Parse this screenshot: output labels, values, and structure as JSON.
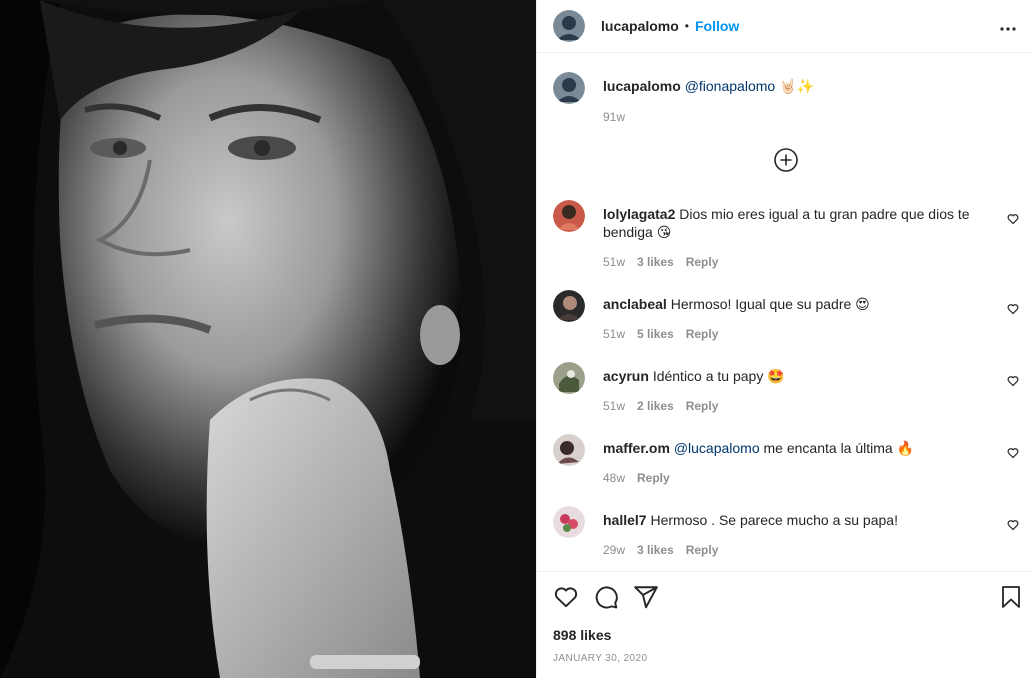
{
  "header": {
    "username": "lucapalomo",
    "separator": "•",
    "follow_label": "Follow"
  },
  "caption": {
    "username": "lucapalomo",
    "mention": "@fionapalomo",
    "emoji": "🤘🏻✨",
    "time": "91w"
  },
  "comments": [
    {
      "username": "lolylagata2",
      "pre": "",
      "mention": "",
      "text": "Dios mio eres igual a tu gran padre que dios te bendiga 😘",
      "time": "51w",
      "likes": "3 likes",
      "reply": "Reply"
    },
    {
      "username": "anclabeal",
      "pre": "",
      "mention": "",
      "text": "Hermoso! Igual que su padre 😍",
      "time": "51w",
      "likes": "5 likes",
      "reply": "Reply"
    },
    {
      "username": "acyrun",
      "pre": "",
      "mention": "",
      "text": "Idéntico a tu papy 🤩",
      "time": "51w",
      "likes": "2 likes",
      "reply": "Reply"
    },
    {
      "username": "maffer.om",
      "pre": "",
      "mention": "@lucapalomo",
      "text": "me encanta la última 🔥",
      "time": "48w",
      "likes": "",
      "reply": "Reply"
    },
    {
      "username": "hallel7",
      "pre": "",
      "mention": "",
      "text": "Hermoso . Se parece mucho a su papa!",
      "time": "29w",
      "likes": "3 likes",
      "reply": "Reply"
    }
  ],
  "footer": {
    "likes": "898 likes",
    "date": "JANUARY 30, 2020"
  },
  "icons": {
    "more": "more-options-icon",
    "add": "add-comment-icon",
    "like": "heart-icon",
    "comment": "comment-icon",
    "share": "share-icon",
    "save": "bookmark-icon"
  },
  "colors": {
    "accent": "#0095f6",
    "mention": "#00376b",
    "muted": "#8e8e8e"
  }
}
